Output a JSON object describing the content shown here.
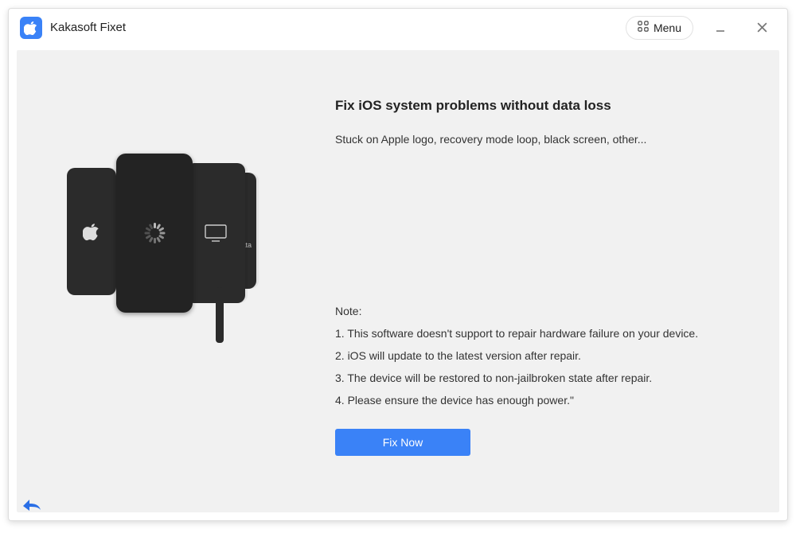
{
  "app": {
    "title": "Kakasoft Fixet",
    "menu_label": "Menu"
  },
  "main": {
    "heading": "Fix iOS system problems without data loss",
    "subtext": "Stuck on Apple logo, recovery mode loop, black screen, other...",
    "note_label": "Note:",
    "notes": [
      "1. This software doesn't support to repair hardware failure on your device.",
      "2. iOS will update to the latest version after repair.",
      "3. The device will be restored to non-jailbroken state after repair.",
      "4. Please ensure the device has enough power.\""
    ],
    "fix_button": "Fix Now",
    "phone_data_label": "data"
  }
}
